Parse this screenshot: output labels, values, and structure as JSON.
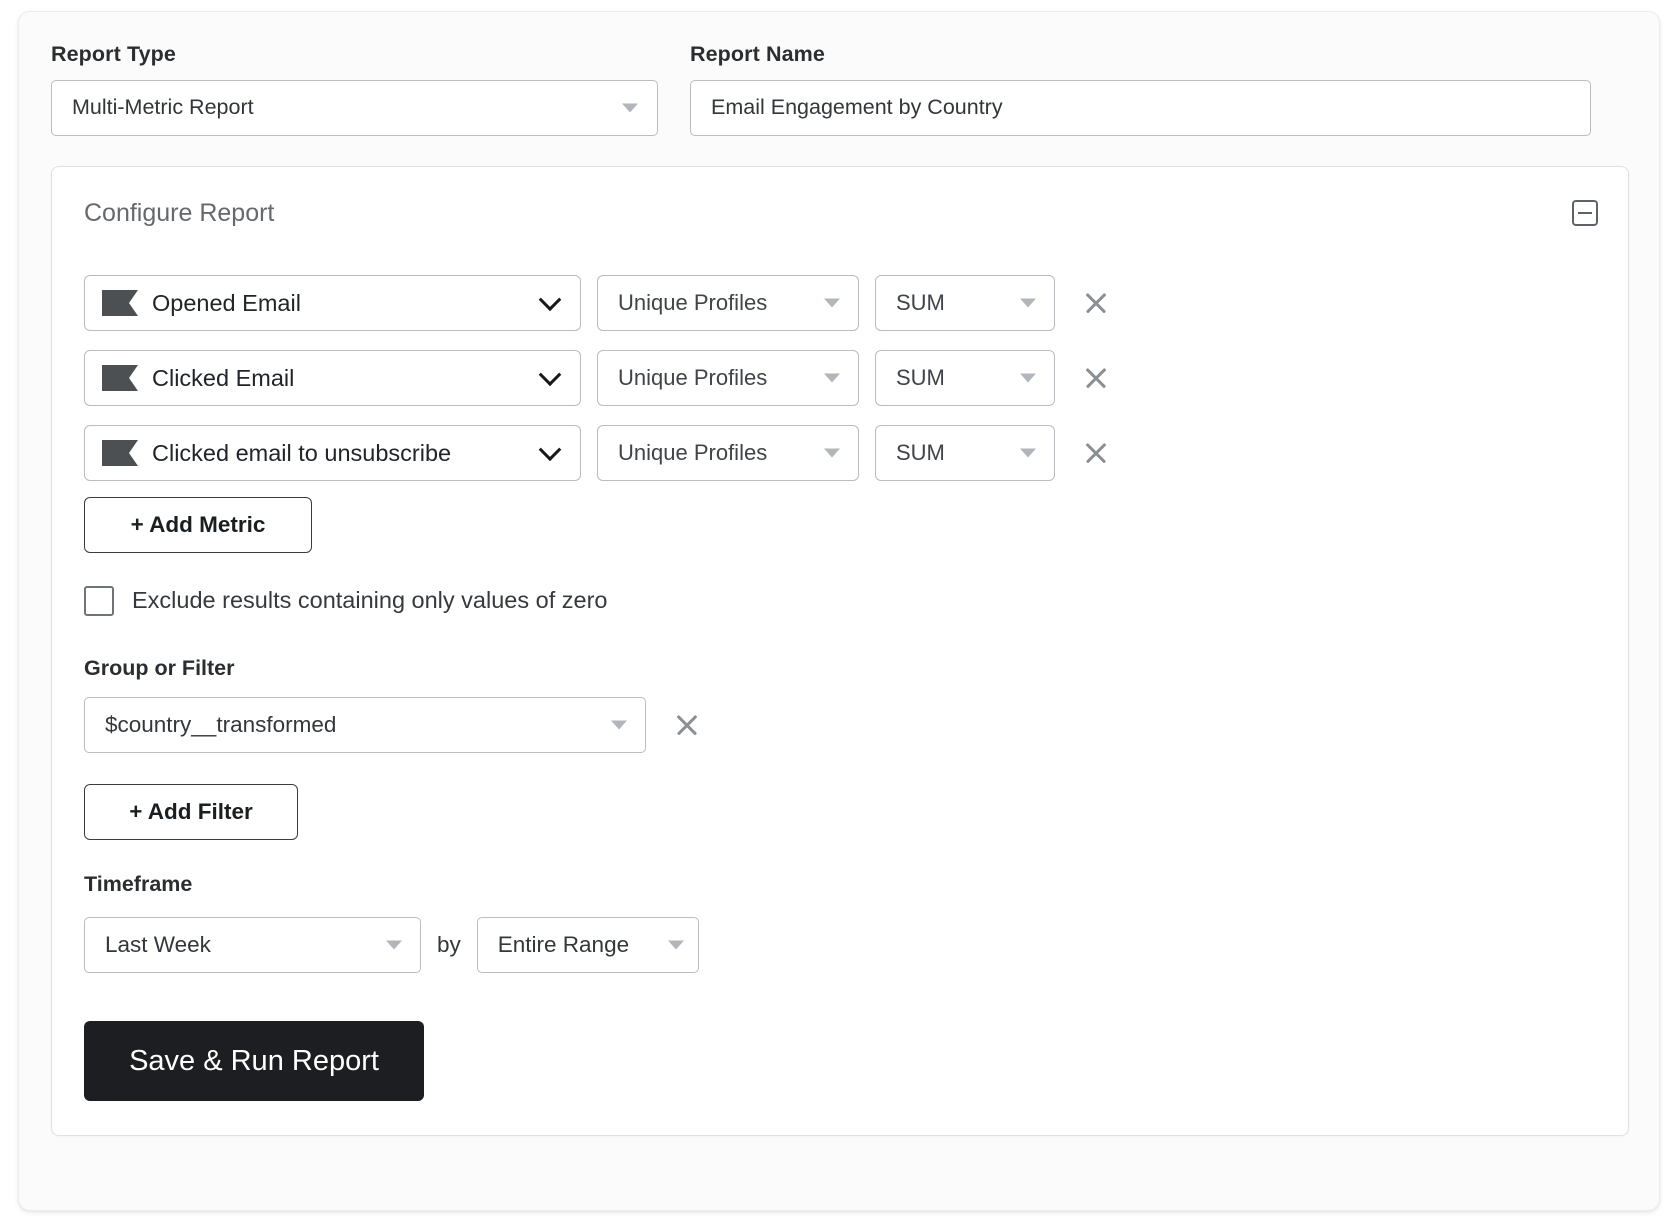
{
  "report_type": {
    "label": "Report Type",
    "value": "Multi-Metric Report"
  },
  "report_name": {
    "label": "Report Name",
    "value": "Email Engagement by Country",
    "placeholder": "Report Name"
  },
  "configure": {
    "title": "Configure Report",
    "collapse_icon": "minus-square-icon",
    "metrics": [
      {
        "icon": "flag-icon",
        "name": "Opened Email",
        "measure": "Unique Profiles",
        "aggregation": "SUM",
        "remove_icon": "close-icon"
      },
      {
        "icon": "flag-icon",
        "name": "Clicked Email",
        "measure": "Unique Profiles",
        "aggregation": "SUM",
        "remove_icon": "close-icon"
      },
      {
        "icon": "flag-icon",
        "name": "Clicked email to unsubscribe",
        "measure": "Unique Profiles",
        "aggregation": "SUM",
        "remove_icon": "close-icon"
      }
    ],
    "add_metric_label": "+ Add Metric",
    "exclude_zero": {
      "label": "Exclude results containing only values of zero",
      "checked": false
    },
    "group_or_filter": {
      "label": "Group or Filter",
      "value": "$country__transformed",
      "remove_icon": "close-icon"
    },
    "add_filter_label": "+ Add Filter",
    "timeframe": {
      "label": "Timeframe",
      "range": "Last Week",
      "connector": "by",
      "interval": "Entire Range"
    },
    "submit_label": "Save & Run Report"
  },
  "colors": {
    "primary_button_bg": "#1c1e21",
    "border": "#b9bcc0",
    "text": "#32363a",
    "muted": "#65696d"
  }
}
